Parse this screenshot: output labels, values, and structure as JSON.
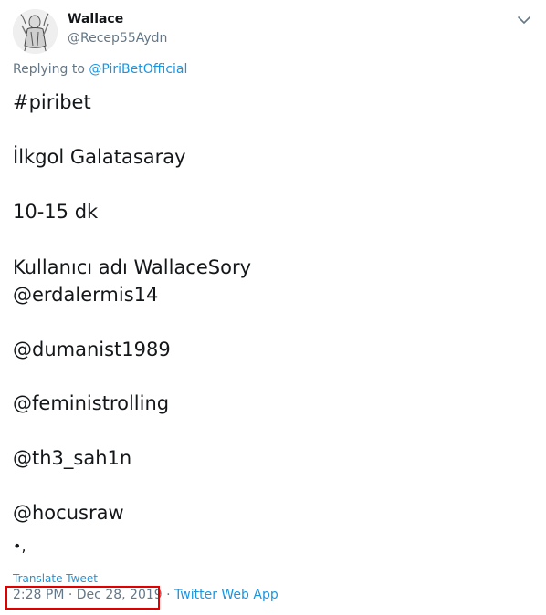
{
  "author": {
    "display_name": "Wallace",
    "handle": "@Recep55Aydn"
  },
  "reply": {
    "prefix": "Replying to",
    "target": "@PiriBetOfficial"
  },
  "body": {
    "hashtag": "#piribet",
    "line_1": "İlkgol Galatasaray",
    "line_2": "10-15 dk",
    "line_3": "Kullanıcı adı WallaceSory",
    "mentions": [
      "@erdalermis14",
      "@dumanist1989",
      "@feministrolling",
      "@th3_sah1n",
      "@hocusraw"
    ],
    "trailing": "•,"
  },
  "translate_label": "Translate Tweet",
  "meta": {
    "time": "2:28 PM",
    "separator": " · ",
    "date": "Dec 28, 2019",
    "separator_2": " · ",
    "source": "Twitter Web App"
  },
  "colors": {
    "link": "#1b95e0",
    "muted": "#657786",
    "text": "#14171a",
    "highlight_box": "#e00000"
  },
  "icons": {
    "menu": "chevron-down-icon",
    "avatar": "profile-photo"
  }
}
